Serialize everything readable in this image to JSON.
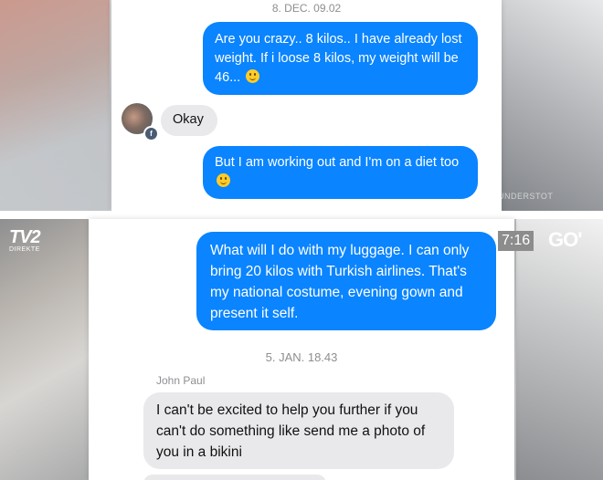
{
  "top_chat": {
    "timestamp": "8. DEC. 09.02",
    "messages": [
      {
        "text": "Are you crazy.. 8 kilos.. I have already lost weight. If i loose 8 kilos, my weight will be 46...",
        "emoji": "slightly-smiling-face"
      },
      {
        "text": "Okay"
      },
      {
        "text": "But I am working out and I'm on a diet too",
        "emoji": "slightly-smiling-face"
      }
    ]
  },
  "bottom_chat": {
    "messages_before": [
      {
        "text": "What will I do with my luggage. I can only bring 20 kilos with Turkish airlines. That's my national costume, evening gown and present it self."
      }
    ],
    "timestamp": "5. JAN. 18.43",
    "sender_name": "John Paul",
    "messages_after": [
      {
        "text": "I can't be excited to help you further if you can't do something like send me a photo of you in a bikini"
      }
    ]
  },
  "overlay": {
    "channel_logo": "TV2",
    "channel_sub": "DIREKTE",
    "clock": "7:16",
    "brand": "GO'",
    "watermark": "UNDERSTOT"
  },
  "colors": {
    "outgoing_bubble": "#0a84ff",
    "incoming_bubble": "#e9e9eb",
    "timestamp_text": "#8e8e93"
  }
}
